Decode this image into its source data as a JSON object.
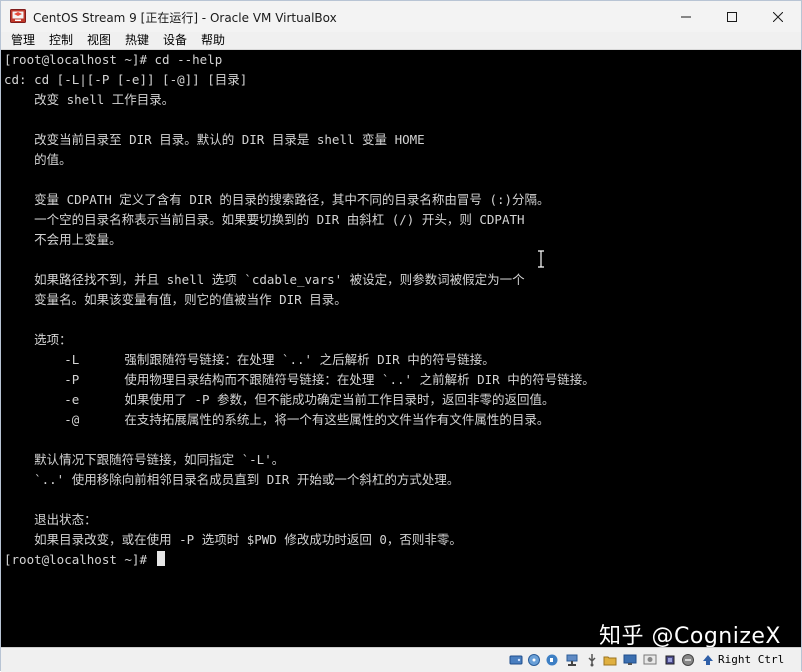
{
  "window": {
    "title": "CentOS Stream 9 [正在运行] - Oracle VM VirtualBox"
  },
  "menu": [
    "管理",
    "控制",
    "视图",
    "热键",
    "设备",
    "帮助"
  ],
  "terminal": {
    "lines": [
      "[root@localhost ~]# cd --help",
      "cd: cd [-L|[-P [-e]] [-@]] [目录]",
      "    改变 shell 工作目录。",
      "",
      "    改变当前目录至 DIR 目录。默认的 DIR 目录是 shell 变量 HOME",
      "    的值。",
      "",
      "    变量 CDPATH 定义了含有 DIR 的目录的搜索路径，其中不同的目录名称由冒号 (:)分隔。",
      "    一个空的目录名称表示当前目录。如果要切换到的 DIR 由斜杠 (/) 开头，则 CDPATH",
      "    不会用上变量。",
      "",
      "    如果路径找不到，并且 shell 选项 `cdable_vars' 被设定，则参数词被假定为一个",
      "    变量名。如果该变量有值，则它的值被当作 DIR 目录。",
      "",
      "    选项：",
      "        -L      强制跟随符号链接：在处理 `..' 之后解析 DIR 中的符号链接。",
      "        -P      使用物理目录结构而不跟随符号链接：在处理 `..' 之前解析 DIR 中的符号链接。",
      "        -e      如果使用了 -P 参数，但不能成功确定当前工作目录时，返回非零的返回值。",
      "        -@      在支持拓展属性的系统上，将一个有这些属性的文件当作有文件属性的目录。",
      "",
      "    默认情况下跟随符号链接，如同指定 `-L'。",
      "    `..' 使用移除向前相邻目录名成员直到 DIR 开始或一个斜杠的方式处理。",
      "",
      "    退出状态：",
      "    如果目录改变，或在使用 -P 选项时 $PWD 修改成功时返回 0，否则非零。"
    ],
    "prompt": "[root@localhost ~]# "
  },
  "watermark": "知乎 @CognizeX",
  "statusbar": {
    "host_key": "Right Ctrl"
  },
  "colors": {
    "terminal_bg": "#000000",
    "terminal_fg": "#d4d4d4",
    "titlebar_bg": "#f3f3f3",
    "menubar_bg": "#f0f0f0"
  }
}
